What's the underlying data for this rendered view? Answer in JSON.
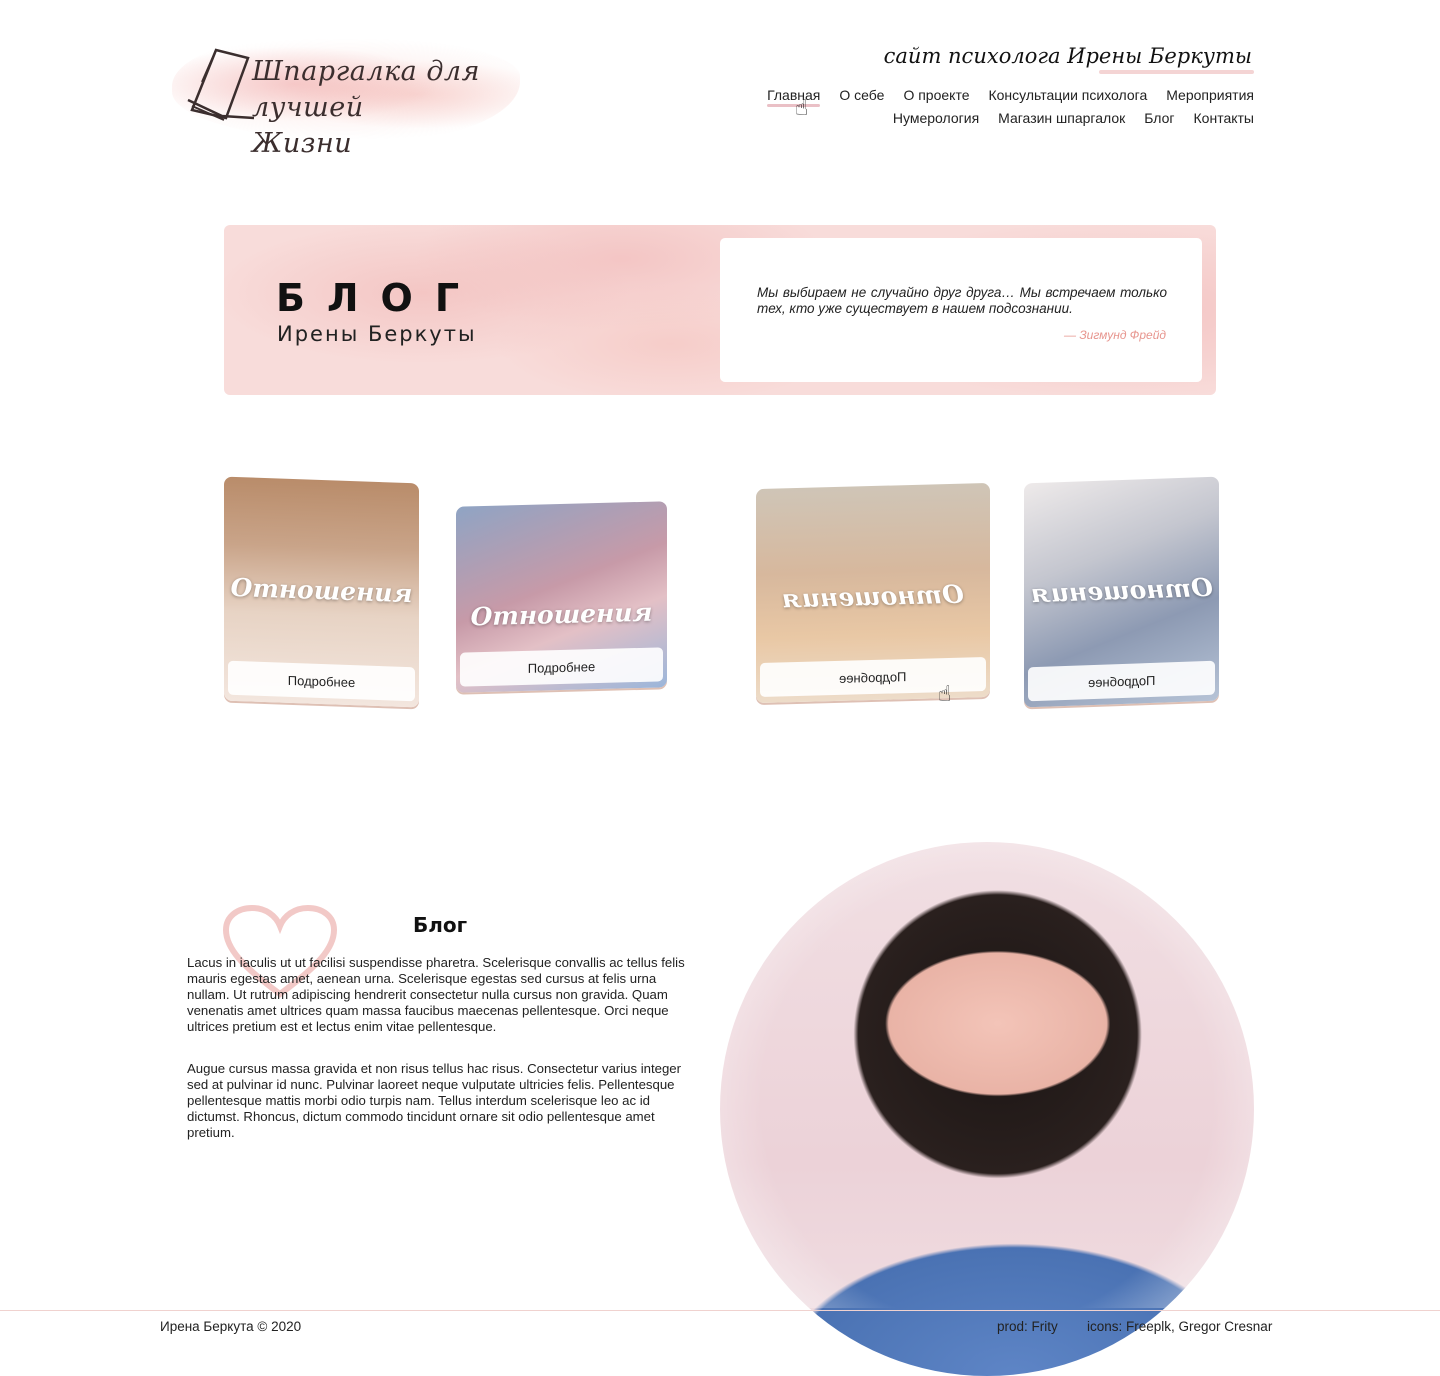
{
  "header": {
    "logo_text_line1": "Шпаргалка для лучшей",
    "logo_text_line2": "Жизни",
    "site_title": "сайт психолога Ирены Беркуты"
  },
  "nav": {
    "row1": [
      "Главная",
      "О себе",
      "О проекте",
      "Консультации психолога",
      "Мероприятия"
    ],
    "row2": [
      "Нумерология",
      "Магазин шпаргалок",
      "Блог",
      "Контакты"
    ],
    "active": "Главная"
  },
  "hero": {
    "title": "БЛОГ",
    "subtitle": "Ирены Беркуты",
    "quote": "Мы выбираем не случайно друг друга… Мы встречаем только тех, кто уже существует в нашем подсознании.",
    "author": "—  Зигмунд Фрейд"
  },
  "cards": [
    {
      "label": "Отношения",
      "button": "Подробнее"
    },
    {
      "label": "Отношения",
      "button": "Подробнее"
    },
    {
      "label": "Отношения",
      "button": "Подробнее"
    },
    {
      "label": "Отношения",
      "button": "Подробнее"
    }
  ],
  "section": {
    "title": "Блог",
    "paragraph1": "Lacus in iaculis ut ut facilisi suspendisse pharetra. Scelerisque convallis ac tellus felis mauris egestas amet, aenean urna. Scelerisque egestas sed cursus at felis urna nullam. Ut rutrum adipiscing hendrerit consectetur nulla cursus non gravida. Quam venenatis amet ultrices quam massa faucibus maecenas pellentesque. Orci neque ultrices pretium est et lectus enim vitae pellentesque.",
    "paragraph2": "Augue cursus massa gravida et non risus tellus hac risus. Consectetur varius integer sed at pulvinar id nunc. Pulvinar laoreet neque vulputate ultricies felis. Pellentesque pellentesque mattis morbi odio turpis nam. Tellus interdum scelerisque leo ac id dictumst. Rhoncus, dictum commodo tincidunt ornare sit odio pellentesque amet pretium."
  },
  "footer": {
    "copyright": "Ирена Беркута © 2020",
    "prod": "prod: Frity",
    "icons": "icons: Freeplk, Gregor Cresnar"
  },
  "colors": {
    "accent_pink": "#e7958e",
    "wash_pink": "#f8dcda"
  }
}
